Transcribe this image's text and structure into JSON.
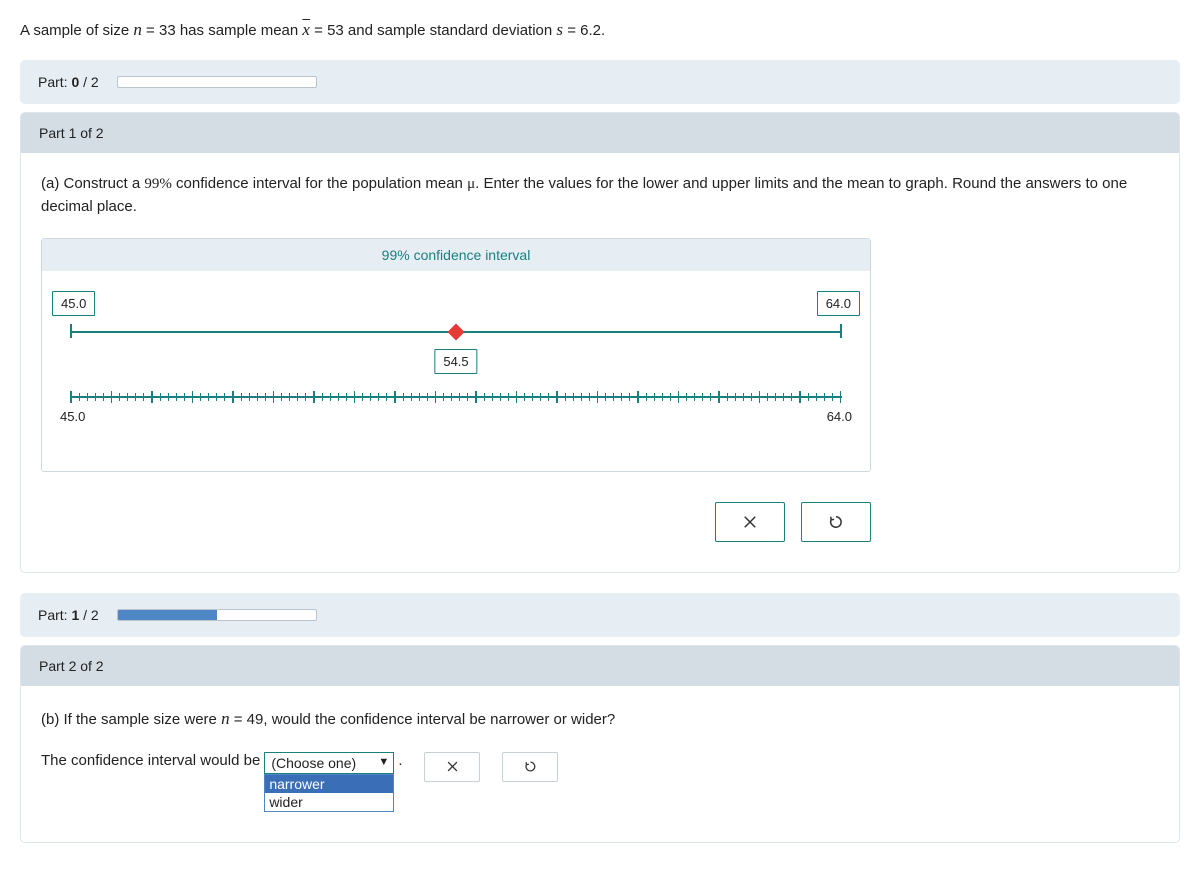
{
  "problem": {
    "prefix": "A sample of size ",
    "n_eq": "n = 33",
    "mid1": " has sample mean ",
    "xbar_eq": "x̄ = 53",
    "mid2": " and sample standard deviation ",
    "s_eq": "s = 6.2",
    "period": "."
  },
  "progress0": {
    "label": "Part: 0 / 2",
    "percent": 0
  },
  "progress1": {
    "label": "Part: 1 / 2",
    "percent": 50
  },
  "part1": {
    "header": "Part 1 of 2",
    "question": "(a) Construct a 99% confidence interval for the population mean μ. Enter the values for the lower and upper limits and the mean to graph. Round the answers to one decimal place.",
    "ci_title": "99% confidence interval",
    "lower": "45.0",
    "upper": "64.0",
    "mean": "54.5",
    "axis_left": "45.0",
    "axis_right": "64.0"
  },
  "part2": {
    "header": "Part 2 of 2",
    "question": "(b) If the sample size were n = 49, would the confidence interval be narrower or wider?",
    "answer_prefix": "The confidence interval would be",
    "dropdown_placeholder": "(Choose one)",
    "options": [
      "narrower",
      "wider"
    ],
    "selected_option": "narrower",
    "dot": "."
  },
  "chart_data": {
    "type": "other",
    "title": "99% confidence interval",
    "lower_limit": 45.0,
    "upper_limit": 64.0,
    "point_estimate": 54.5,
    "xlim": [
      45.0,
      64.0
    ]
  }
}
